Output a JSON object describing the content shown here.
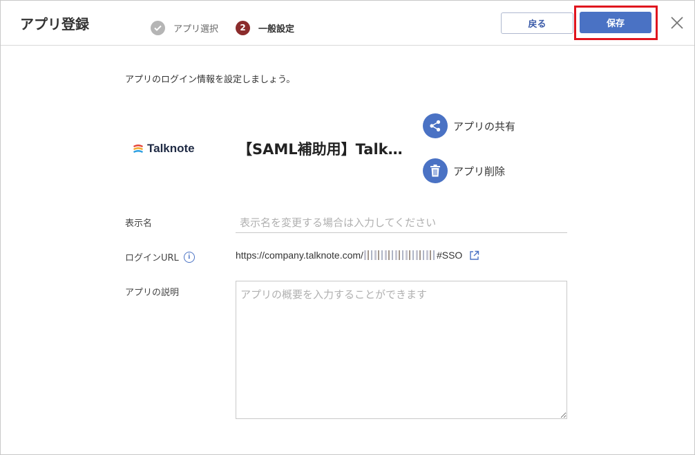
{
  "header": {
    "title": "アプリ登録",
    "steps": [
      {
        "marker": "✓",
        "label": "アプリ選択"
      },
      {
        "marker": "2",
        "label": "一般設定"
      }
    ],
    "back_label": "戻る",
    "save_label": "保存"
  },
  "intro": "アプリのログイン情報を設定しましょう。",
  "app": {
    "logo_text": "Talknote",
    "name": "【SAML補助用】Talknote",
    "share_label": "アプリの共有",
    "delete_label": "アプリ削除"
  },
  "form": {
    "display_name_label": "表示名",
    "display_name_placeholder": "表示名を変更する場合は入力してください",
    "display_name_value": "",
    "login_url_label": "ログインURL",
    "login_url_prefix": "https://company.talknote.com/",
    "login_url_suffix": "#SSO",
    "description_label": "アプリの説明",
    "description_placeholder": "アプリの概要を入力することができます",
    "description_value": ""
  },
  "colors": {
    "accent": "#4a72c4",
    "highlight": "#e0141e",
    "step_active": "#8b2c2c",
    "step_done": "#b5b5b5"
  }
}
